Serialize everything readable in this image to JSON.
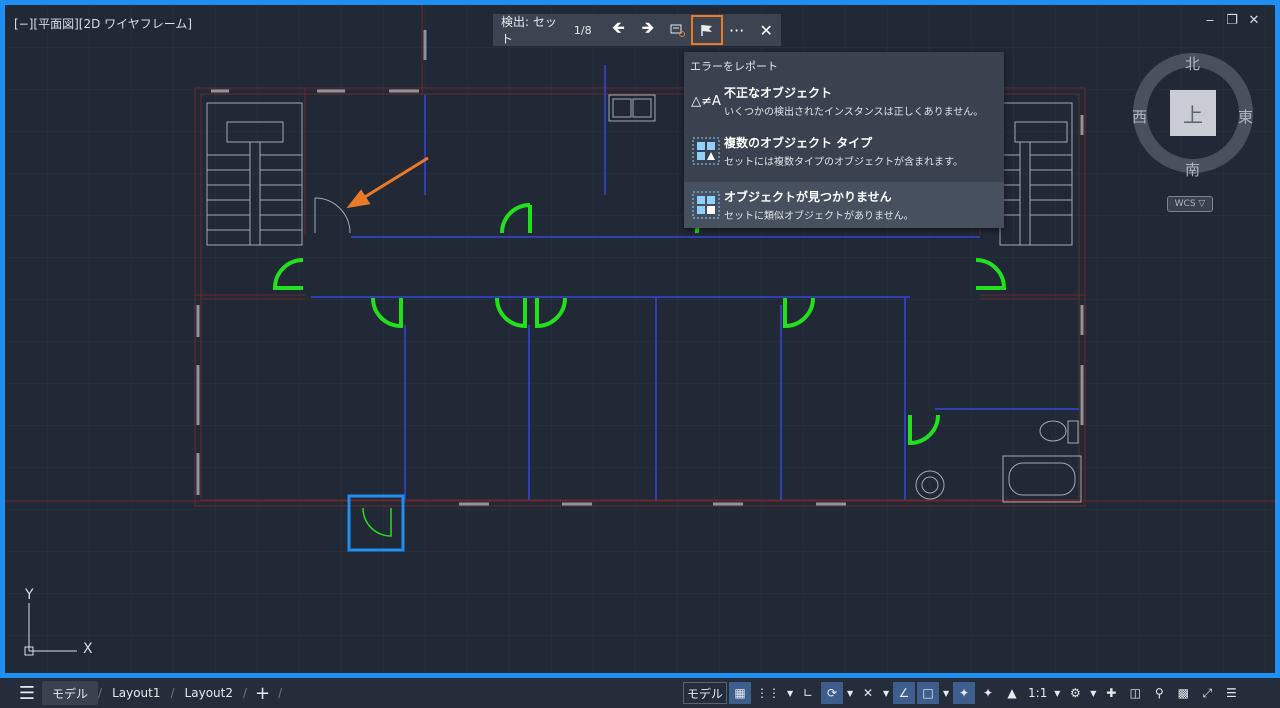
{
  "viewport": {
    "label": "[−][平面図][2D ワイヤフレーム]"
  },
  "window_controls": {
    "minimize": "‒",
    "restore": "❐",
    "close": "✕"
  },
  "detect_toolbar": {
    "label": "検出: セット",
    "counter": "1/8",
    "prev_icon": "arrow-left-icon",
    "next_icon": "arrow-right-icon",
    "zoom_icon": "zoom-to-object-icon",
    "flag_icon": "flag-icon",
    "more_label": "···",
    "close_label": "✕"
  },
  "report_menu": {
    "header": "エラーをレポート",
    "items": [
      {
        "title": "不正なオブジェクト",
        "desc": "いくつかの検出されたインスタンスは正しくありません。",
        "icon": "not-equal-icon",
        "icon_text": "△≠A"
      },
      {
        "title": "複数のオブジェクト タイプ",
        "desc": "セットには複数タイプのオブジェクトが含まれます。",
        "icon": "multiple-types-icon"
      },
      {
        "title": "オブジェクトが見つかりません",
        "desc": "セットに類似オブジェクトがありません。",
        "icon": "object-missing-icon"
      }
    ]
  },
  "viewcube": {
    "north": "北",
    "south": "南",
    "east": "東",
    "west": "西",
    "top": "上",
    "wcs": "WCS ▽"
  },
  "ucs": {
    "x": "X",
    "y": "Y"
  },
  "bottom_tabs": {
    "model": "モデル",
    "layout1": "Layout1",
    "layout2": "Layout2",
    "add": "+"
  },
  "status_bar": {
    "model": "モデル",
    "scale": "1:1"
  },
  "colors": {
    "accent": "#1f8ff2",
    "highlight": "#ea7a27",
    "door": "#22e01e",
    "wall": "#2f3fb0",
    "grid": "#2b3342"
  }
}
